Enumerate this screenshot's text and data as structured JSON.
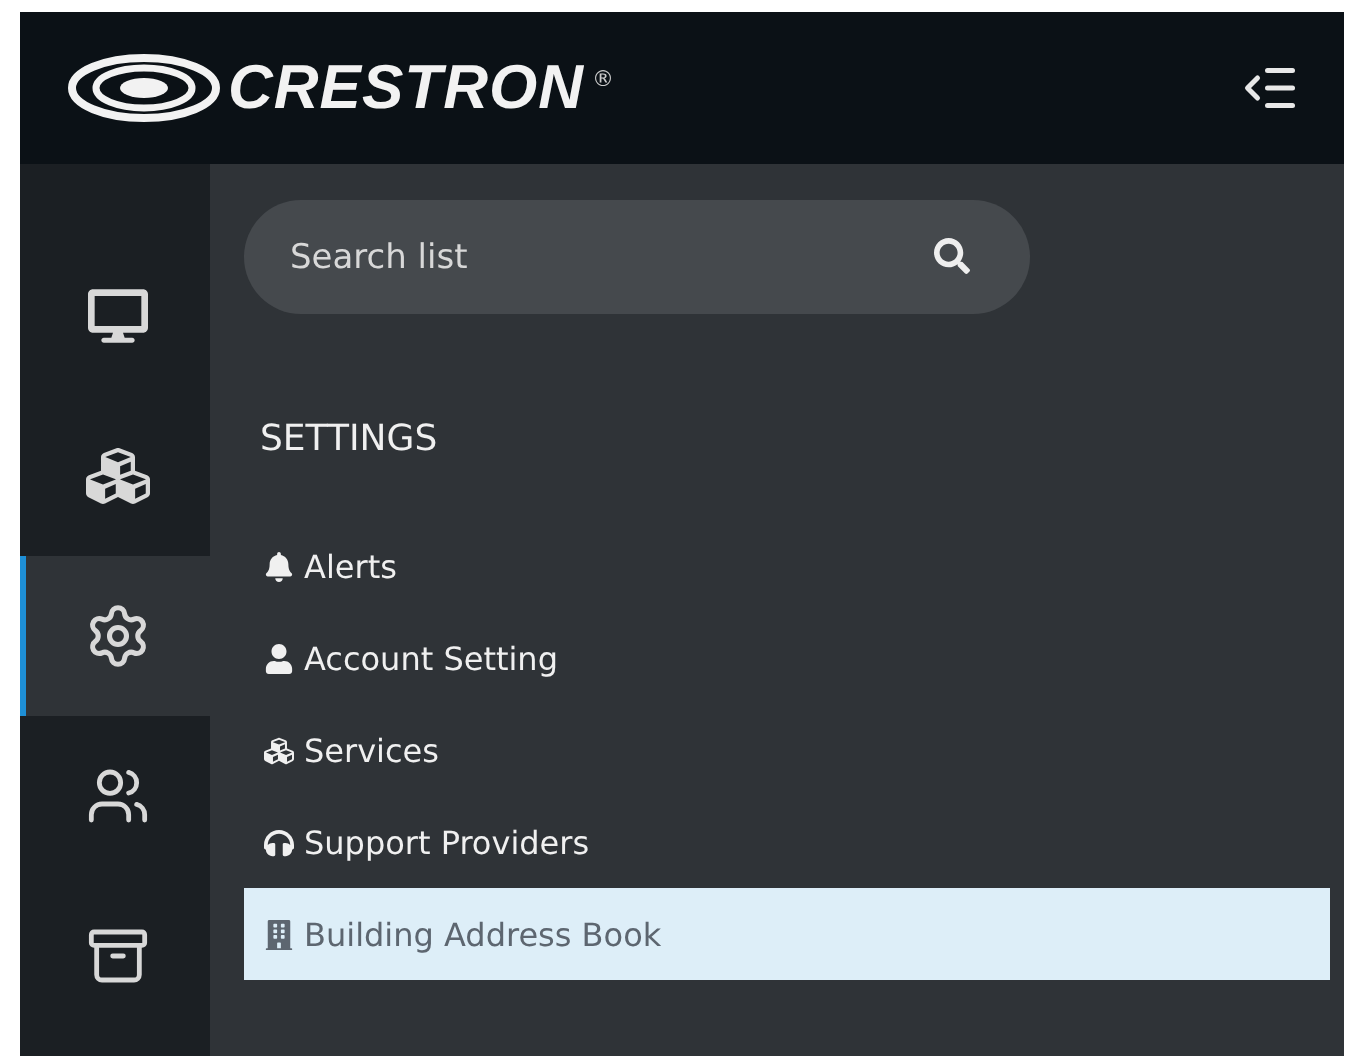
{
  "header": {
    "logo_text": "CRESTRON",
    "registered_mark": "®"
  },
  "rail": [
    {
      "selected": false
    },
    {
      "selected": false
    },
    {
      "selected": true
    },
    {
      "selected": false
    },
    {
      "selected": false
    }
  ],
  "search": {
    "placeholder": "Search list"
  },
  "section": {
    "title": "SETTINGS"
  },
  "items": [
    {
      "label": "Alerts",
      "selected": false
    },
    {
      "label": "Account Setting",
      "selected": false
    },
    {
      "label": "Services",
      "selected": false
    },
    {
      "label": "Support Providers",
      "selected": false
    },
    {
      "label": "Building Address Book",
      "selected": true
    }
  ]
}
